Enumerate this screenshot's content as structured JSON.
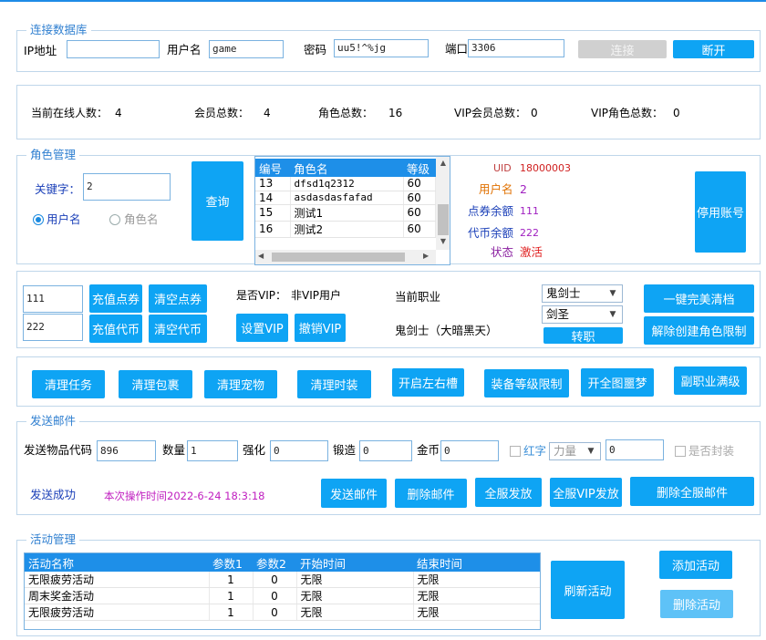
{
  "colors": {
    "accent": "#0ea4f4",
    "title": "#2f7fd0",
    "disabled": "#d0d0d0"
  },
  "connect": {
    "title": "连接数据库",
    "ip_label": "IP地址",
    "ip_value": "",
    "user_label": "用户名",
    "user_value": "game",
    "pwd_label": "密码",
    "pwd_value": "uu5!^%jg",
    "port_label": "端口",
    "port_value": "3306",
    "connect_btn": "连接",
    "disconnect_btn": "断开"
  },
  "stats": {
    "online_label": "当前在线人数：",
    "online": "4",
    "members_label": "会员总数：",
    "members": "4",
    "roles_label": "角色总数：",
    "roles": "16",
    "vip_members_label": "VIP会员总数：",
    "vip_members": "0",
    "vip_roles_label": "VIP角色总数：",
    "vip_roles": "0"
  },
  "role": {
    "title": "角色管理",
    "keyword_label": "关键字：",
    "keyword_value": "2",
    "radio_user": "用户名",
    "radio_role": "角色名",
    "query_btn": "查询",
    "columns": [
      "编号",
      "角色名",
      "等级"
    ],
    "rows": [
      [
        "13",
        "dfsd1q2312",
        "60"
      ],
      [
        "14",
        "asdasdasfafad",
        "60"
      ],
      [
        "15",
        "测试1",
        "60"
      ],
      [
        "16",
        "测试2",
        "60"
      ]
    ],
    "uid_label": "UID",
    "uid_value": "18000003",
    "name_label": "用户名",
    "name_value": "2",
    "points_label": "点券余额",
    "points_value": "111",
    "coins_label": "代币余额",
    "coins_value": "222",
    "status_label": "状态",
    "status_value": "激活",
    "disable_btn": "停用账号"
  },
  "recharge": {
    "points_value": "111",
    "coins_value": "222",
    "charge_points_btn": "充值点券",
    "clear_points_btn": "清空点券",
    "charge_coins_btn": "充值代币",
    "clear_coins_btn": "清空代币",
    "vip_label": "是否VIP：",
    "vip_value": "非VIP用户",
    "set_vip_btn": "设置VIP",
    "cancel_vip_btn": "撤销VIP",
    "job_label": "当前职业",
    "job_current": "鬼剑士（大暗黑天）",
    "job_select1": "鬼剑士",
    "job_select2": "剑圣",
    "change_job_btn": "转职",
    "clear_archive_btn": "一键完美清档",
    "remove_limit_btn": "解除创建角色限制"
  },
  "actions": [
    "清理任务",
    "清理包裹",
    "清理宠物",
    "清理时装",
    "开启左右槽",
    "装备等级限制",
    "开全图噩梦",
    "副职业满级"
  ],
  "mail": {
    "title": "发送邮件",
    "code_label": "发送物品代码",
    "code_value": "896",
    "qty_label": "数量",
    "qty_value": "1",
    "enhance_label": "强化",
    "enhance_value": "0",
    "forge_label": "锻造",
    "forge_value": "0",
    "gold_label": "金币",
    "gold_value": "0",
    "red_label": "红字",
    "stat_select": "力量",
    "stat_value": "0",
    "seal_label": "是否封装",
    "status": "发送成功",
    "op_time": "本次操作时间2022-6-24 18:3:18",
    "send_btn": "发送邮件",
    "delete_btn": "删除邮件",
    "all_send_btn": "全服发放",
    "all_vip_btn": "全服VIP发放",
    "delete_all_btn": "删除全服邮件"
  },
  "activity": {
    "title": "活动管理",
    "columns": [
      "活动名称",
      "参数1",
      "参数2",
      "开始时间",
      "结束时间"
    ],
    "rows": [
      [
        "无限疲劳活动",
        "1",
        "0",
        "无限",
        "无限"
      ],
      [
        "周末奖金活动",
        "1",
        "0",
        "无限",
        "无限"
      ],
      [
        "无限疲劳活动",
        "1",
        "0",
        "无限",
        "无限"
      ]
    ],
    "refresh_btn": "刷新活动",
    "add_btn": "添加活动",
    "delete_btn": "删除活动"
  }
}
